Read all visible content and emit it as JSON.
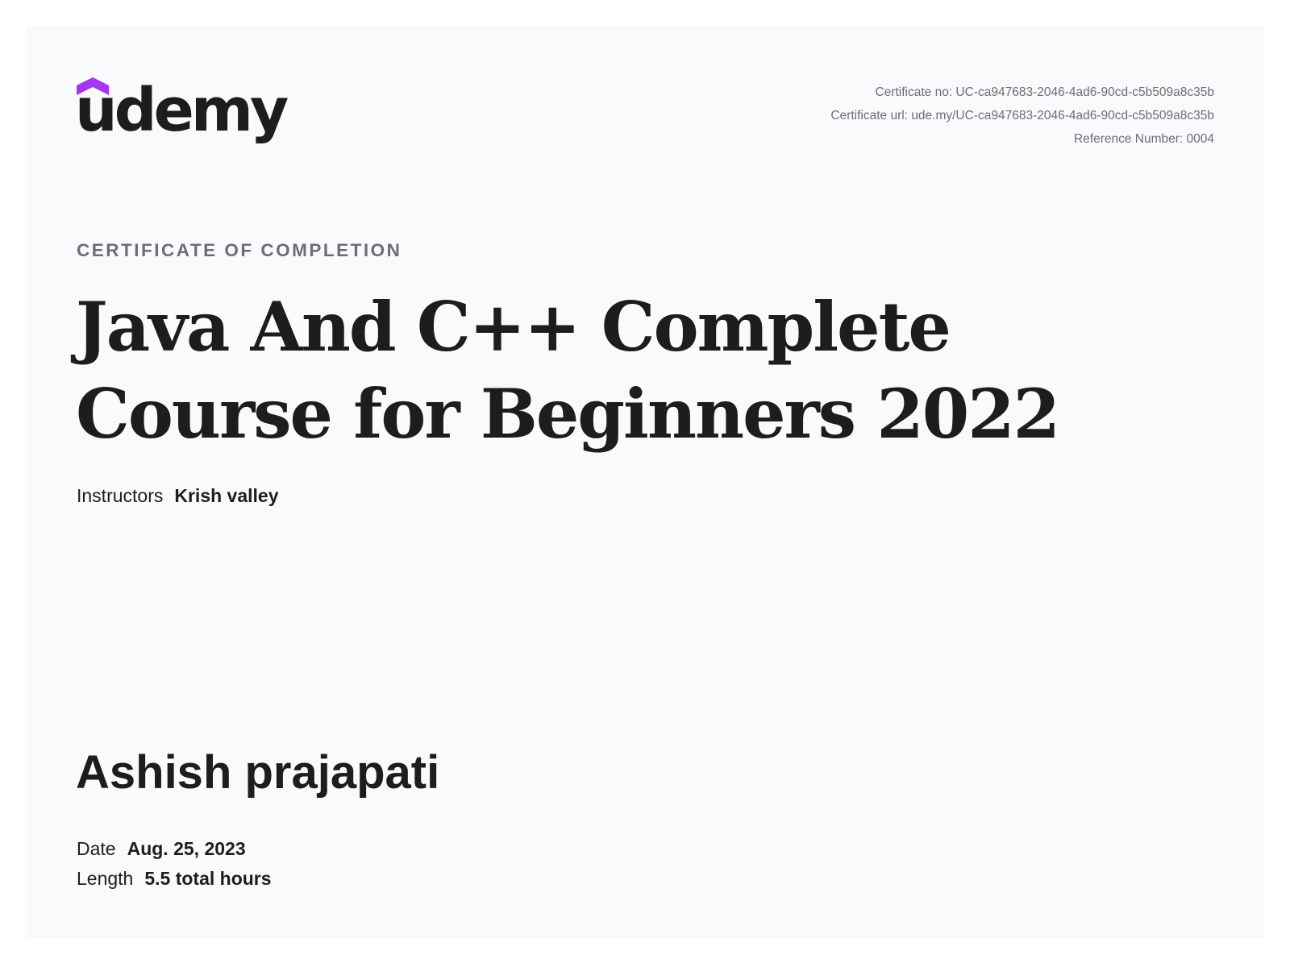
{
  "brand": {
    "logo_text": "udemy",
    "accent_color": "#a435f0"
  },
  "meta": {
    "certificate_no": "Certificate no: UC-ca947683-2046-4ad6-90cd-c5b509a8c35b",
    "certificate_url": "Certificate url: ude.my/UC-ca947683-2046-4ad6-90cd-c5b509a8c35b",
    "reference_number": "Reference Number: 0004"
  },
  "certificate": {
    "eyebrow": "CERTIFICATE OF COMPLETION",
    "course_title": "Java And C++ Complete Course for Beginners 2022",
    "instructors_label": "Instructors",
    "instructors_value": "Krish valley",
    "student_name": "Ashish prajapati",
    "date_label": "Date",
    "date_value": "Aug. 25, 2023",
    "length_label": "Length",
    "length_value": "5.5 total hours"
  }
}
